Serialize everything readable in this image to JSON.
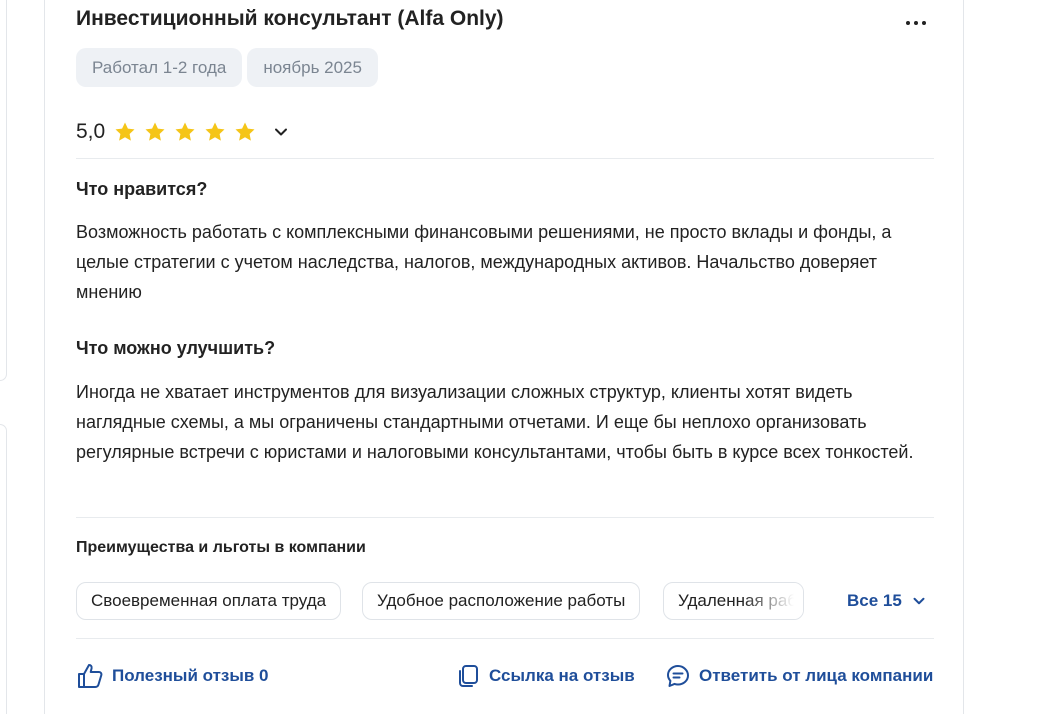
{
  "review": {
    "title": "Инвестиционный консультант (Alfa Only)",
    "tags": [
      "Работал 1-2 года",
      "ноябрь 2025"
    ],
    "rating": "5,0",
    "stars": 5,
    "likes_title": "Что нравится?",
    "likes_text": "Возможность работать с комплексными финансовыми решениями, не просто вклады и фонды, а целые стратегии с учетом наследства, налогов, международных активов. Начальство доверяет мнению",
    "improve_title": "Что можно улучшить?",
    "improve_text": "Иногда не хватает инструментов для визуализации сложных структур, клиенты хотят видеть наглядные схемы, а мы ограничены стандартными отчетами. И еще бы неплохо организовать регулярные встречи с юристами и налоговыми консультантами, чтобы быть в курсе всех тонкостей."
  },
  "benefits": {
    "title": "Преимущества и льготы в компании",
    "items": [
      "Своевременная оплата труда",
      "Удобное расположение работы",
      "Удаленная работа"
    ],
    "all_label": "Все 15"
  },
  "actions": {
    "helpful": "Полезный отзыв 0",
    "link": "Ссылка на отзыв",
    "reply": "Ответить от лица компании"
  },
  "colors": {
    "accent": "#1f4e9a",
    "star": "#f5c518",
    "tag_bg": "#eef1f5",
    "tag_text": "#7b8591"
  },
  "icons": {
    "menu": "more-dots-icon",
    "expand": "chevron-down-icon",
    "helpful": "thumbs-up-icon",
    "link": "copy-icon",
    "reply": "chat-bubble-icon"
  }
}
